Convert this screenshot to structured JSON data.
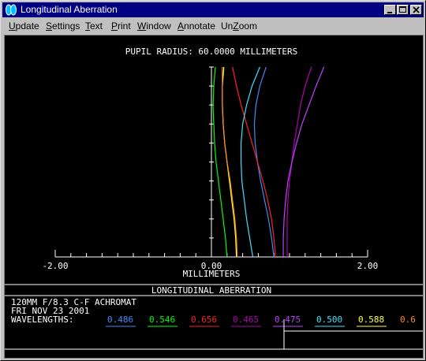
{
  "window": {
    "title": "Longitudinal Aberration",
    "icon": "app-lens-icon",
    "controls": [
      "minimize-icon",
      "maximize-icon",
      "close-icon"
    ]
  },
  "menu": {
    "items": [
      {
        "label": "Update",
        "underline": "U"
      },
      {
        "label": "Settings",
        "underline": "S"
      },
      {
        "label": "Text",
        "underline": "T"
      },
      {
        "label": "Print",
        "underline": "P"
      },
      {
        "label": "Window",
        "underline": "W"
      },
      {
        "label": "Annotate",
        "underline": "A"
      },
      {
        "label": "UnZoom",
        "underline": "Z"
      }
    ]
  },
  "chart_data": {
    "type": "line",
    "title": "PUPIL RADIUS: 60.0000 MILLIMETERS",
    "xlabel": "MILLIMETERS",
    "ylabel": "",
    "xlim": [
      -2.0,
      2.0
    ],
    "ylim": [
      0,
      1
    ],
    "x_tick_labels": [
      "-2.00",
      "0.00",
      "2.00"
    ],
    "x_minor_step": 0.2,
    "y_minor_step": 0.1,
    "grid": false,
    "axis_color": "#ffffff",
    "series": [
      {
        "name": "0.486",
        "color": "#3c8cff",
        "points": [
          [
            0.8,
            0
          ],
          [
            0.77,
            0.1
          ],
          [
            0.73,
            0.2
          ],
          [
            0.68,
            0.3
          ],
          [
            0.63,
            0.4
          ],
          [
            0.59,
            0.5
          ],
          [
            0.56,
            0.6
          ],
          [
            0.55,
            0.7
          ],
          [
            0.57,
            0.8
          ],
          [
            0.62,
            0.9
          ],
          [
            0.7,
            1.0
          ]
        ]
      },
      {
        "name": "0.546",
        "color": "#00ff00",
        "points": [
          [
            0.2,
            0
          ],
          [
            0.18,
            0.1
          ],
          [
            0.15,
            0.2
          ],
          [
            0.12,
            0.3
          ],
          [
            0.09,
            0.4
          ],
          [
            0.06,
            0.5
          ],
          [
            0.04,
            0.6
          ],
          [
            0.03,
            0.7
          ],
          [
            0.02,
            0.8
          ],
          [
            0.03,
            0.9
          ],
          [
            0.05,
            1.0
          ]
        ]
      },
      {
        "name": "0.656",
        "color": "#ff2020",
        "points": [
          [
            0.82,
            0
          ],
          [
            0.8,
            0.1
          ],
          [
            0.77,
            0.2
          ],
          [
            0.72,
            0.3
          ],
          [
            0.66,
            0.4
          ],
          [
            0.59,
            0.5
          ],
          [
            0.52,
            0.6
          ],
          [
            0.45,
            0.7
          ],
          [
            0.38,
            0.8
          ],
          [
            0.32,
            0.9
          ],
          [
            0.27,
            1.0
          ]
        ]
      },
      {
        "name": "0.465",
        "color": "#b000b0",
        "points": [
          [
            0.97,
            0
          ],
          [
            0.97,
            0.1
          ],
          [
            0.97,
            0.2
          ],
          [
            0.98,
            0.3
          ],
          [
            1.0,
            0.4
          ],
          [
            1.03,
            0.5
          ],
          [
            1.06,
            0.6
          ],
          [
            1.1,
            0.7
          ],
          [
            1.14,
            0.8
          ],
          [
            1.2,
            0.9
          ],
          [
            1.28,
            1.0
          ]
        ]
      },
      {
        "name": "0.475",
        "color": "#c040ff",
        "points": [
          [
            0.92,
            0
          ],
          [
            0.92,
            0.1
          ],
          [
            0.93,
            0.2
          ],
          [
            0.95,
            0.3
          ],
          [
            0.98,
            0.4
          ],
          [
            1.03,
            0.5
          ],
          [
            1.09,
            0.6
          ],
          [
            1.16,
            0.7
          ],
          [
            1.25,
            0.8
          ],
          [
            1.34,
            0.9
          ],
          [
            1.44,
            1.0
          ]
        ]
      },
      {
        "name": "0.500",
        "color": "#40e0ff",
        "points": [
          [
            0.53,
            0
          ],
          [
            0.49,
            0.1
          ],
          [
            0.45,
            0.2
          ],
          [
            0.42,
            0.3
          ],
          [
            0.39,
            0.4
          ],
          [
            0.38,
            0.5
          ],
          [
            0.38,
            0.6
          ],
          [
            0.4,
            0.7
          ],
          [
            0.45,
            0.8
          ],
          [
            0.52,
            0.9
          ],
          [
            0.62,
            1.0
          ]
        ]
      },
      {
        "name": "0.588",
        "color": "#ffff40",
        "points": [
          [
            0.32,
            0
          ],
          [
            0.31,
            0.1
          ],
          [
            0.29,
            0.2
          ],
          [
            0.26,
            0.3
          ],
          [
            0.23,
            0.4
          ],
          [
            0.2,
            0.5
          ],
          [
            0.17,
            0.6
          ],
          [
            0.15,
            0.7
          ],
          [
            0.14,
            0.8
          ],
          [
            0.14,
            0.9
          ],
          [
            0.16,
            1.0
          ]
        ]
      },
      {
        "name": "0.6",
        "color": "#ff8c1a",
        "points": [
          [
            0.33,
            0
          ],
          [
            0.32,
            0.1
          ],
          [
            0.3,
            0.2
          ],
          [
            0.27,
            0.3
          ],
          [
            0.24,
            0.4
          ],
          [
            0.2,
            0.5
          ],
          [
            0.17,
            0.6
          ],
          [
            0.15,
            0.7
          ],
          [
            0.14,
            0.8
          ],
          [
            0.14,
            0.9
          ],
          [
            0.14,
            1.0
          ]
        ]
      }
    ]
  },
  "info": {
    "banner": "LONGITUDINAL ABERRATION",
    "lens": "120MM F/8.3  C-F ACHROMAT",
    "date": "FRI NOV 23 2001",
    "wavelengths_label": "WAVELENGTHS:"
  }
}
